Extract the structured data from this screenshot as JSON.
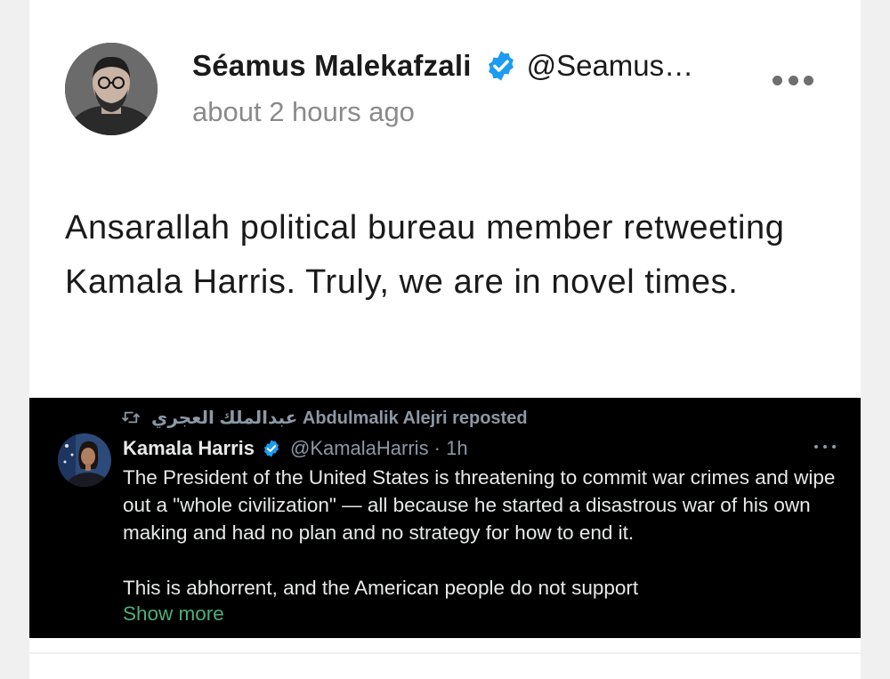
{
  "post": {
    "author_name": "Séamus Malekafzali",
    "author_handle": "@Seamus…",
    "timestamp": "about 2 hours ago",
    "text": "Ansarallah political bureau member retweeting Kamala Harris. Truly, we are in novel times."
  },
  "icons": {
    "verified": "verified-badge-icon",
    "more": "more-horizontal-icon",
    "repost": "repost-icon"
  },
  "colors": {
    "verified_blue": "#1d9bf0",
    "show_more_green": "#4caf7a",
    "embed_background": "#000000"
  },
  "embed": {
    "repost_text": "عبدالملك العجري Abdulmalik Alejri reposted",
    "author_name": "Kamala Harris",
    "author_handle": "@KamalaHarris · 1h",
    "paragraph1": "The President of the United States is threatening to commit war crimes and wipe out a \"whole civilization\" — all because he started a disastrous war of his own making and had no plan and no strategy for how to end it.",
    "paragraph2": "This is abhorrent, and the American people do not support",
    "show_more": "Show more"
  }
}
